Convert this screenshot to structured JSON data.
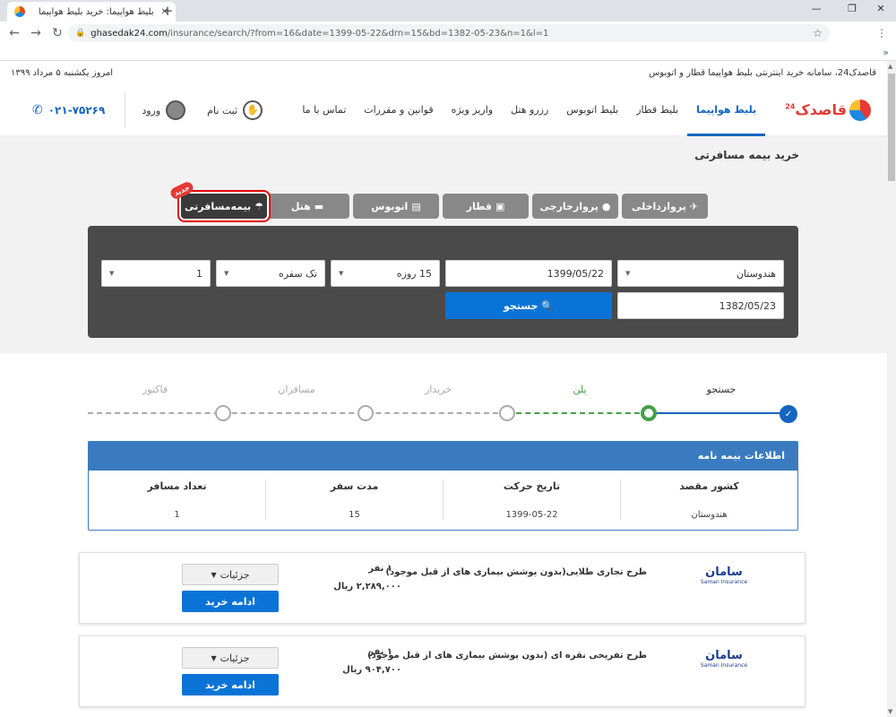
{
  "browser": {
    "tab_title": "بلیط هواپیما: خرید بلیط هواپیما",
    "url_host": "ghasedak24.com",
    "url_rest": "/insurance/search/?from=16&date=1399-05-22&drn=15&bd=1382-05-23&n=1&l=1"
  },
  "topline": {
    "tagline": "قاصدک24، سامانه خرید اینترنتی بلیط هواپیما قطار و اتوبوس",
    "today": "امروز یکشنبه ۵ مرداد ۱۳۹۹"
  },
  "header": {
    "logo_text": "قاصدک",
    "logo_number": "24",
    "nav": [
      "بلیط هواپیما",
      "بلیط قطار",
      "بلیط اتوبوس",
      "رزرو هتل",
      "واریز ویژه",
      "قوانین و مقررات",
      "تماس با ما"
    ],
    "signup": "ثبت نام",
    "login": "ورود",
    "phone": "۰۲۱-۷۵۲۶۹"
  },
  "page_heading": "خرید بیمه مسافرتی",
  "search_tabs": [
    {
      "label": "پروازداخلی",
      "icon": "plane-icon",
      "glyph": "✈"
    },
    {
      "label": "پروازخارجی",
      "icon": "globe-icon",
      "glyph": "●"
    },
    {
      "label": "قطار",
      "icon": "train-icon",
      "glyph": "▣"
    },
    {
      "label": "اتوبوس",
      "icon": "bus-icon",
      "glyph": "▤"
    },
    {
      "label": "هتل",
      "icon": "bed-icon",
      "glyph": "▬"
    },
    {
      "label": "بیمه‌مسافرتی",
      "icon": "umbrella-icon",
      "glyph": "☂"
    }
  ],
  "new_badge": "جدید",
  "search": {
    "destination": "هندوستان",
    "departure_date": "1399/05/22",
    "duration": "15 روزه",
    "trip_type": "تک سفره",
    "passengers": "1",
    "birth_date": "1382/05/23",
    "search_label": "جستجو"
  },
  "steps": [
    "جستجو",
    "پلن",
    "خریدار",
    "مسافران",
    "فاکتور"
  ],
  "info": {
    "title": "اطلاعات بیمه نامه",
    "columns": [
      {
        "k": "کشور مقصد",
        "v": "هندوستان"
      },
      {
        "k": "تاریخ حرکت",
        "v": "1399-05-22"
      },
      {
        "k": "مدت سفر",
        "v": "15"
      },
      {
        "k": "تعداد مسافر",
        "v": "1"
      }
    ]
  },
  "plans": [
    {
      "logo": "سامان",
      "logo_sub": "Saman Insurance",
      "title": "طرح تجاری طلایی(بدون پوشش بیماری های از قبل موجود)",
      "count": "۱ نفر",
      "price": "۲,۲۸۹,۰۰۰ ریال",
      "details": "جزئیات",
      "buy": "ادامه خرید"
    },
    {
      "logo": "سامان",
      "logo_sub": "Saman Insurance",
      "title": "طرح تفریحی نقره ای (بدون پوشش بیماری های از قبل موجود)",
      "count": "۱ نفر",
      "price": "۹۰۴,۷۰۰ ریال",
      "details": "جزئیات",
      "buy": "ادامه خرید"
    }
  ],
  "colors": {
    "primary": "#0a74d6",
    "info_header": "#3a7bc0",
    "step_done": "#1565c0",
    "step_current": "#43a047",
    "highlight": "#e30000"
  }
}
